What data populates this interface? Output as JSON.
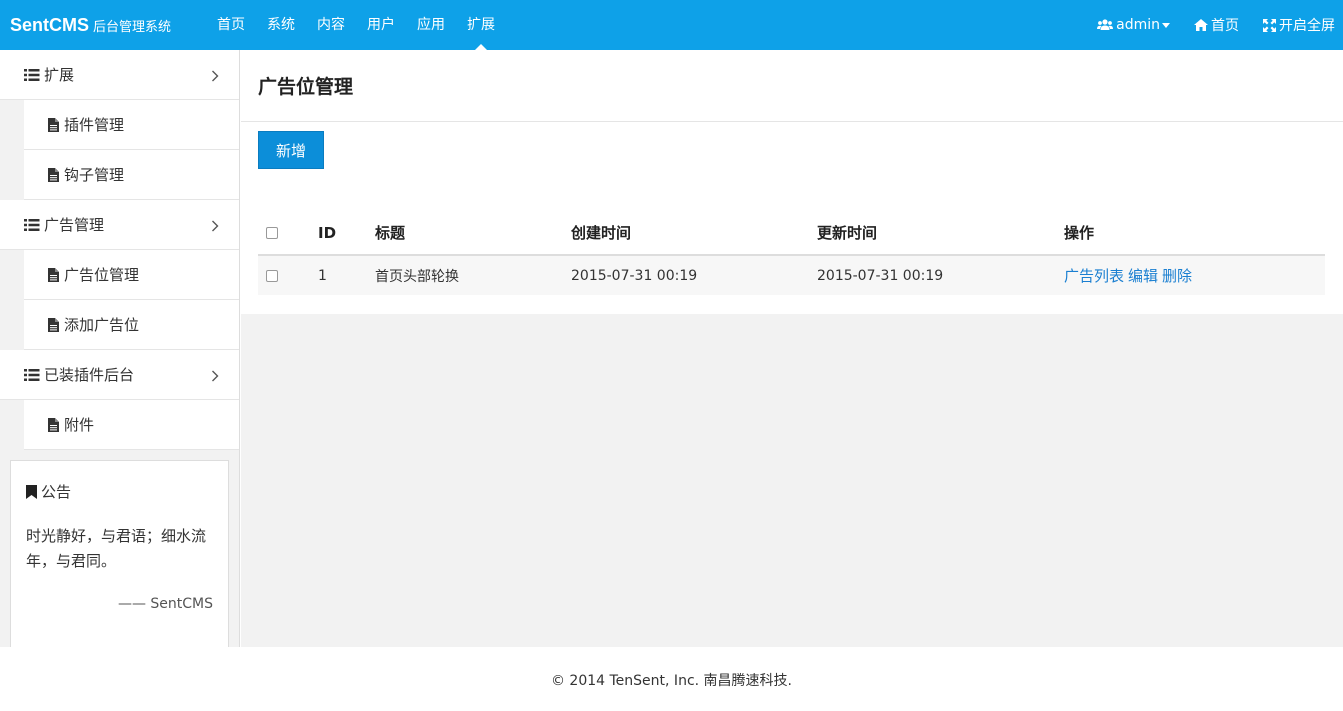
{
  "brand": {
    "name": "SentCMS",
    "subtitle": "后台管理系统"
  },
  "nav": {
    "items": [
      "首页",
      "系统",
      "内容",
      "用户",
      "应用",
      "扩展"
    ],
    "active_index": 5,
    "user": "admin",
    "home": "首页",
    "fullscreen": "开启全屏"
  },
  "sidebar": {
    "groups": [
      {
        "label": "扩展",
        "items": [
          "插件管理",
          "钩子管理"
        ]
      },
      {
        "label": "广告管理",
        "items": [
          "广告位管理",
          "添加广告位"
        ]
      },
      {
        "label": "已装插件后台",
        "items": [
          "附件"
        ]
      }
    ],
    "notice": {
      "title": "公告",
      "text": "时光静好，与君语；细水流年，与君同。",
      "signature": "—— SentCMS"
    }
  },
  "main": {
    "title": "广告位管理",
    "add_button": "新增",
    "table": {
      "headers": [
        "ID",
        "标题",
        "创建时间",
        "更新时间",
        "操作"
      ],
      "rows": [
        {
          "id": "1",
          "title": "首页头部轮换",
          "created": "2015-07-31 00:19",
          "updated": "2015-07-31 00:19",
          "actions": [
            "广告列表",
            "编辑",
            "删除"
          ]
        }
      ]
    }
  },
  "footer": {
    "text": "© 2014 TenSent, Inc. 南昌腾速科技."
  },
  "colors": {
    "navbar": "#0ea1e8",
    "primary_button": "#0c8ed9",
    "link": "#1a7fd1"
  }
}
